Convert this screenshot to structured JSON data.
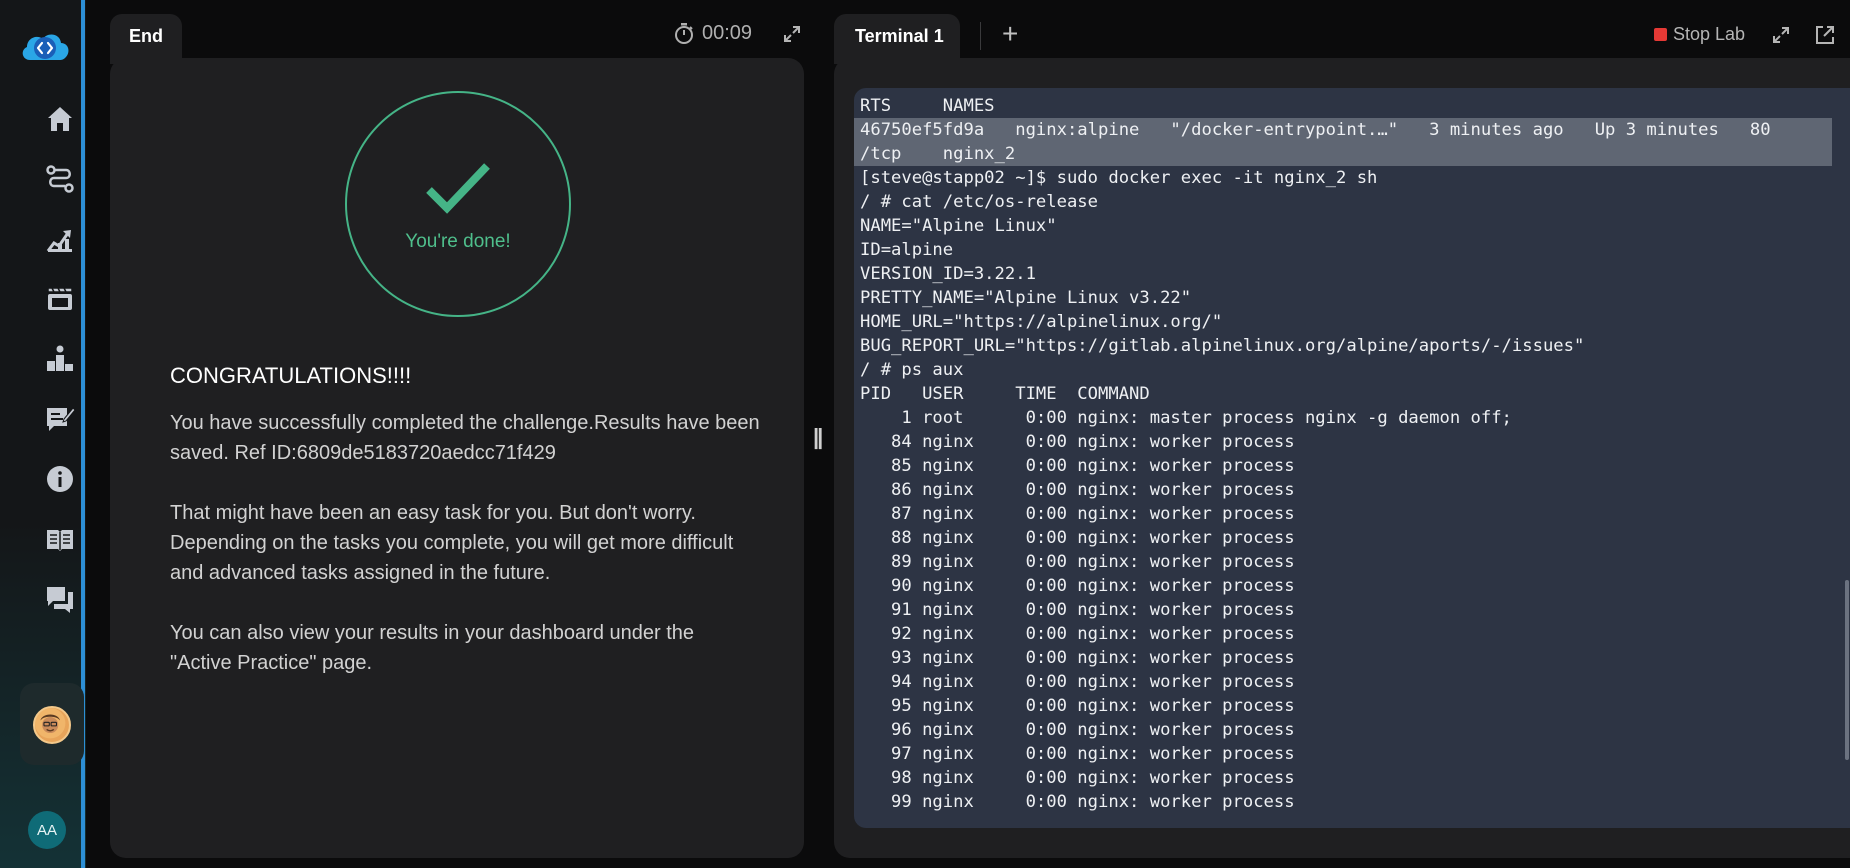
{
  "sidebar": {
    "logo": "cloud-code-logo",
    "items": [
      {
        "icon": "home-icon"
      },
      {
        "icon": "path-icon"
      },
      {
        "icon": "growth-chart-icon"
      },
      {
        "icon": "video-icon"
      },
      {
        "icon": "leaderboard-icon"
      },
      {
        "icon": "notes-icon"
      },
      {
        "icon": "info-icon"
      },
      {
        "icon": "book-icon"
      },
      {
        "icon": "chat-icon"
      }
    ],
    "user_initials": "AA"
  },
  "left": {
    "tab_label": "End",
    "timer": "00:09",
    "done_label": "You're done!",
    "heading": "CONGRATULATIONS!!!!",
    "p1": "You have successfully completed the challenge.Results have been saved. Ref ID:6809de5183720aedcc71f429",
    "p2": "That might have been an easy task for you. But don't worry. Depending on the tasks you complete, you will get more difficult and advanced tasks assigned in the future.",
    "p3": "You can also view your results in your dashboard under the \"Active Practice\" page.",
    "accent_color": "#45b487"
  },
  "right": {
    "tab_label": "Terminal 1",
    "add_tab": "+",
    "stop_label": "Stop Lab",
    "stop_color": "#e53935"
  },
  "terminal": {
    "lines": [
      "RTS     NAMES",
      "46750ef5fd9a   nginx:alpine   \"/docker-entrypoint.…\"   3 minutes ago   Up 3 minutes   80",
      "/tcp    nginx_2",
      "[steve@stapp02 ~]$ sudo docker exec -it nginx_2 sh",
      "/ # cat /etc/os-release",
      "NAME=\"Alpine Linux\"",
      "ID=alpine",
      "VERSION_ID=3.22.1",
      "PRETTY_NAME=\"Alpine Linux v3.22\"",
      "HOME_URL=\"https://alpinelinux.org/\"",
      "BUG_REPORT_URL=\"https://gitlab.alpinelinux.org/alpine/aports/-/issues\"",
      "/ # ps aux",
      "PID   USER     TIME  COMMAND",
      "    1 root      0:00 nginx: master process nginx -g daemon off;",
      "   84 nginx     0:00 nginx: worker process",
      "   85 nginx     0:00 nginx: worker process",
      "   86 nginx     0:00 nginx: worker process",
      "   87 nginx     0:00 nginx: worker process",
      "   88 nginx     0:00 nginx: worker process",
      "   89 nginx     0:00 nginx: worker process",
      "   90 nginx     0:00 nginx: worker process",
      "   91 nginx     0:00 nginx: worker process",
      "   92 nginx     0:00 nginx: worker process",
      "   93 nginx     0:00 nginx: worker process",
      "   94 nginx     0:00 nginx: worker process",
      "   95 nginx     0:00 nginx: worker process",
      "   96 nginx     0:00 nginx: worker process",
      "   97 nginx     0:00 nginx: worker process",
      "   98 nginx     0:00 nginx: worker process",
      "   99 nginx     0:00 nginx: worker process"
    ],
    "selected_lines": [
      1,
      2
    ],
    "background": "#2d3444"
  }
}
